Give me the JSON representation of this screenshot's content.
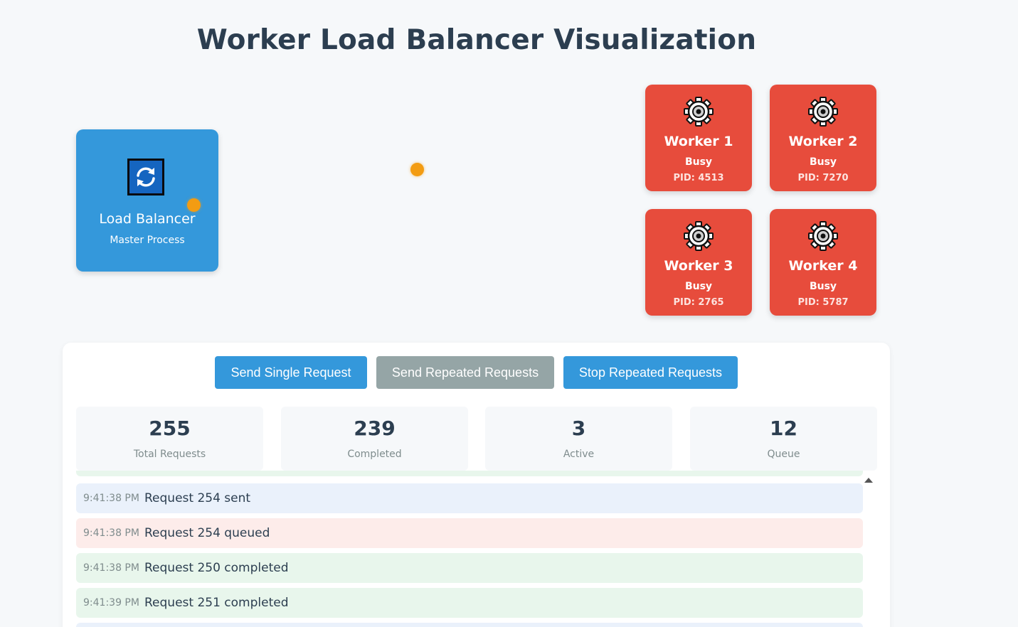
{
  "page": {
    "title": "Worker Load Balancer Visualization"
  },
  "load_balancer": {
    "name": "Load Balancer",
    "subtitle": "Master Process",
    "icon": "refresh-icon"
  },
  "workers": [
    {
      "name": "Worker 1",
      "status": "Busy",
      "pid": "PID: 4513",
      "icon": "gear-icon"
    },
    {
      "name": "Worker 2",
      "status": "Busy",
      "pid": "PID: 7270",
      "icon": "gear-icon"
    },
    {
      "name": "Worker 3",
      "status": "Busy",
      "pid": "PID: 2765",
      "icon": "gear-icon"
    },
    {
      "name": "Worker 4",
      "status": "Busy",
      "pid": "PID: 5787",
      "icon": "gear-icon"
    }
  ],
  "controls": {
    "send_single": "Send Single Request",
    "send_repeated": "Send Repeated Requests",
    "stop_repeated": "Stop Repeated Requests"
  },
  "stats": [
    {
      "value": "255",
      "label": "Total Requests"
    },
    {
      "value": "239",
      "label": "Completed"
    },
    {
      "value": "3",
      "label": "Active"
    },
    {
      "value": "12",
      "label": "Queue"
    }
  ],
  "log": [
    {
      "time": "9:41:38 PM",
      "message": "Request 254 sent",
      "type": "sent"
    },
    {
      "time": "9:41:38 PM",
      "message": "Request 254 queued",
      "type": "queued"
    },
    {
      "time": "9:41:38 PM",
      "message": "Request 250 completed",
      "type": "completed"
    },
    {
      "time": "9:41:39 PM",
      "message": "Request 251 completed",
      "type": "completed"
    }
  ],
  "colors": {
    "lb": "#3498db",
    "worker_busy": "#e74c3c",
    "request_dot": "#f39c12",
    "btn_primary": "#3498db",
    "btn_disabled": "#95a5a6",
    "log_sent": "#eaf1fb",
    "log_queued": "#fdecea",
    "log_completed": "#e8f6ec"
  }
}
